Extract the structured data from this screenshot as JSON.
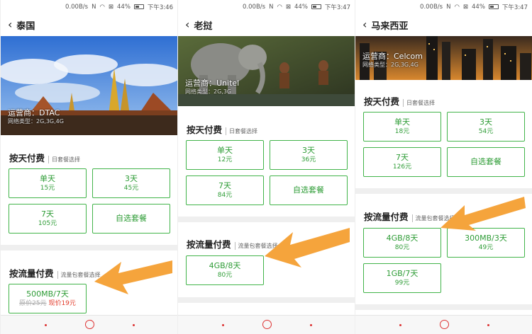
{
  "status": {
    "speed": "0.00B/s",
    "battery": "44%",
    "times": [
      "下午3:46",
      "下午3:47",
      "下午3:47"
    ]
  },
  "panels": [
    {
      "title": "泰国",
      "operator": "运营商：DTAC",
      "network": "网络类型：2G,3G,4G",
      "daily_title": "按天付费",
      "daily_sub": "日套餐选择",
      "daily": [
        {
          "name": "单天",
          "price": "15元"
        },
        {
          "name": "3天",
          "price": "45元"
        },
        {
          "name": "7天",
          "price": "105元"
        },
        {
          "name": "自选套餐"
        }
      ],
      "data_title": "按流量付费",
      "data_sub": "流量包套餐选择",
      "data": [
        {
          "name": "500MB/7天",
          "old_price": "原价25元",
          "new_price": "现价19元"
        }
      ]
    },
    {
      "title": "老挝",
      "operator": "运营商：Unitel",
      "network": "网络类型：2G,3G",
      "daily_title": "按天付费",
      "daily_sub": "日套餐选择",
      "daily": [
        {
          "name": "单天",
          "price": "12元"
        },
        {
          "name": "3天",
          "price": "36元"
        },
        {
          "name": "7天",
          "price": "84元"
        },
        {
          "name": "自选套餐"
        }
      ],
      "data_title": "按流量付费",
      "data_sub": "流量包套餐选择",
      "data": [
        {
          "name": "4GB/8天",
          "price": "80元"
        }
      ]
    },
    {
      "title": "马来西亚",
      "operator": "运营商：Celcom",
      "network": "网络类型：2G,3G,4G",
      "daily_title": "按天付费",
      "daily_sub": "日套餐选择",
      "daily": [
        {
          "name": "单天",
          "price": "18元"
        },
        {
          "name": "3天",
          "price": "54元"
        },
        {
          "name": "7天",
          "price": "126元"
        },
        {
          "name": "自选套餐"
        }
      ],
      "data_title": "按流量付费",
      "data_sub": "流量包套餐选择",
      "data": [
        {
          "name": "4GB/8天",
          "price": "80元"
        },
        {
          "name": "300MB/3天",
          "price": "49元"
        },
        {
          "name": "1GB/7天",
          "price": "99元"
        }
      ]
    }
  ],
  "colors": {
    "accent": "#42b44a",
    "arrow": "#f5a43c",
    "nav": "#d33333"
  }
}
